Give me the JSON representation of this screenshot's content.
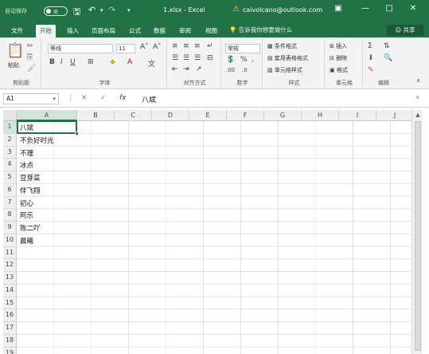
{
  "titlebar": {
    "autosave_label": "自动保存",
    "autosave_state": "关",
    "file_name": "1.xlsx  -  Excel",
    "account": "caivolcano@outlook.com"
  },
  "tabs": [
    "文件",
    "开始",
    "插入",
    "页面布局",
    "公式",
    "数据",
    "审阅",
    "视图"
  ],
  "active_tab": "开始",
  "tell_me": "告诉我你想要做什么",
  "share_label": "共享",
  "ribbon": {
    "clipboard": {
      "paste_label": "粘贴",
      "group_label": "剪贴板"
    },
    "font": {
      "font_name": "等线",
      "font_size": "11",
      "group_label": "字体"
    },
    "alignment": {
      "group_label": "对齐方式"
    },
    "number": {
      "format": "常规",
      "group_label": "数字"
    },
    "styles": {
      "items": [
        "条件格式",
        "套用表格格式",
        "单元格样式"
      ],
      "group_label": "样式"
    },
    "cells": {
      "items": [
        "插入",
        "删除",
        "格式"
      ],
      "group_label": "单元格"
    },
    "editing": {
      "group_label": "编辑"
    }
  },
  "formula_bar": {
    "name_box": "A1",
    "fx_label": "fx",
    "content": "八斌"
  },
  "columns": [
    "A",
    "B",
    "C",
    "D",
    "E",
    "F",
    "G",
    "H",
    "I",
    "J",
    "K"
  ],
  "rows": [
    "1",
    "2",
    "3",
    "4",
    "5",
    "6",
    "7",
    "8",
    "9",
    "10",
    "11",
    "12",
    "13",
    "14",
    "15",
    "16",
    "17",
    "18",
    "19"
  ],
  "cells": {
    "A": [
      "八斌",
      "不负好时光",
      "不理",
      "冰点",
      "豆芽菜",
      "伴飞翔",
      "初心",
      "阿乐",
      "陈二吖",
      "晨曦"
    ]
  },
  "selected_cell": "A1"
}
